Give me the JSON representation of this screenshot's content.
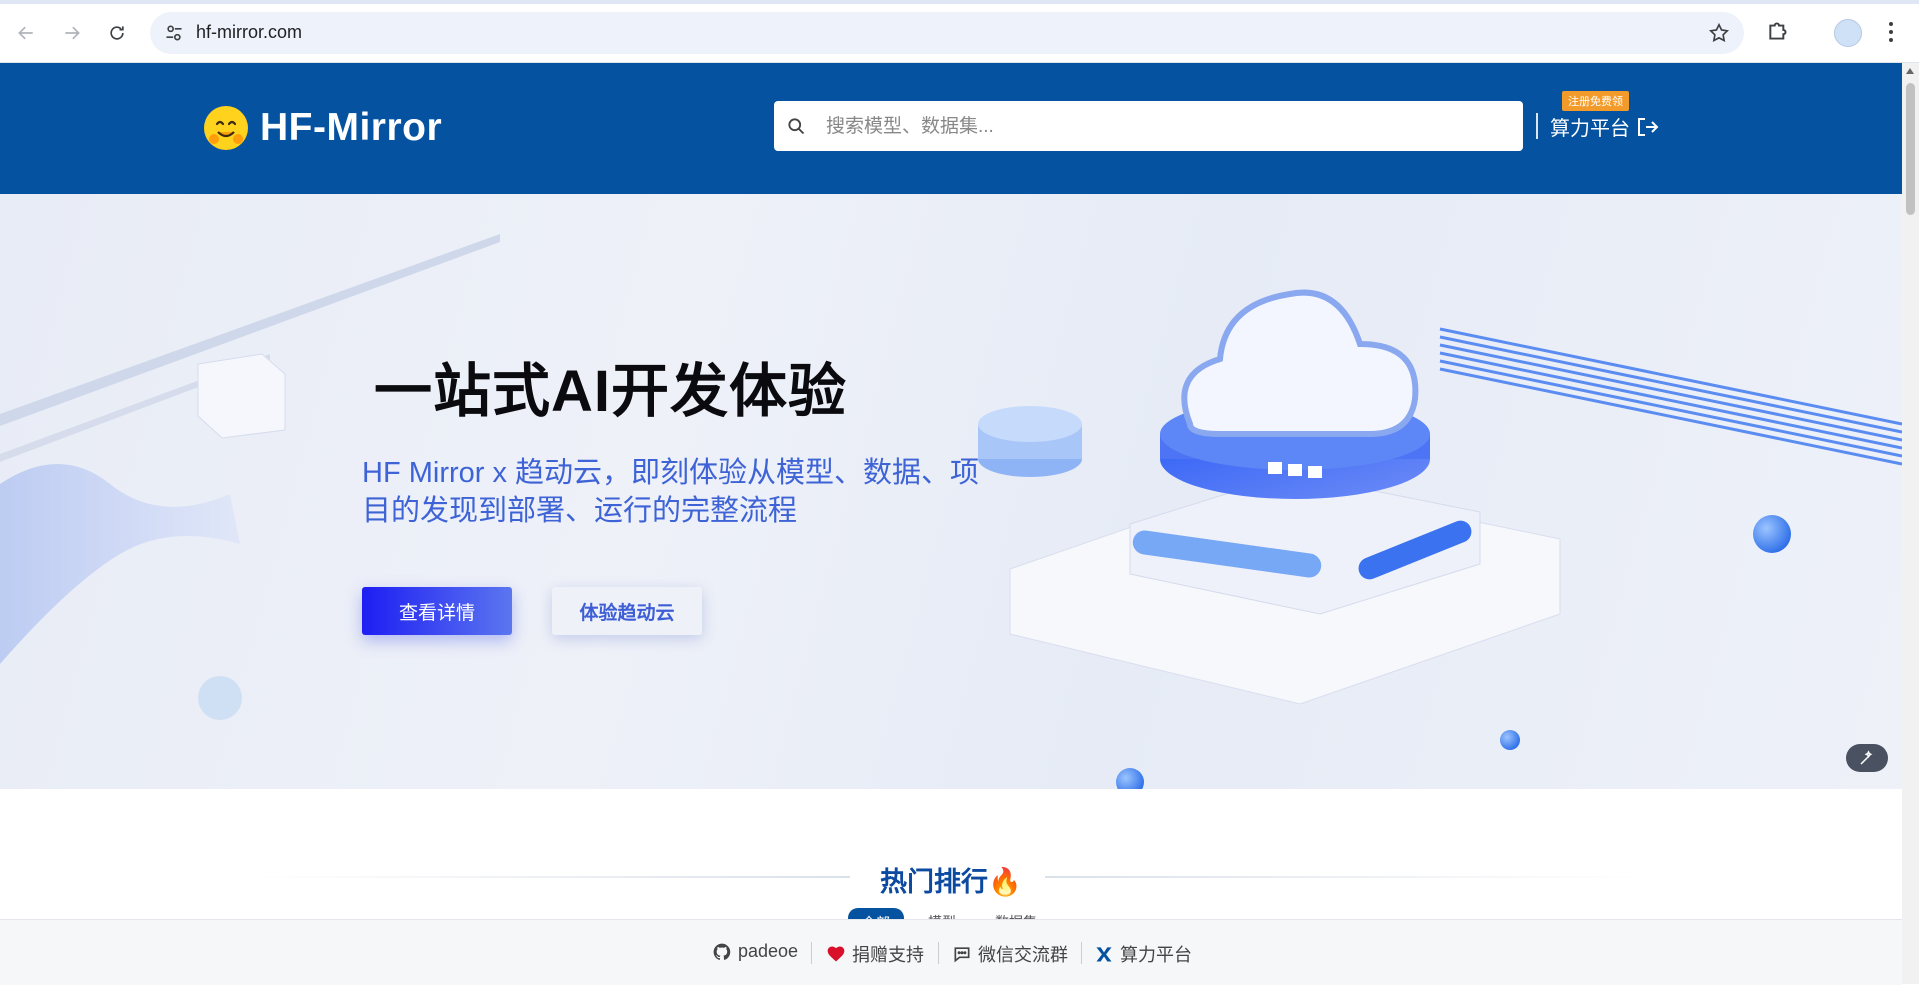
{
  "browser": {
    "url": "hf-mirror.com",
    "icons": {
      "back": "arrow-left-icon",
      "forward": "arrow-right-icon",
      "reload": "reload-icon",
      "site_info": "tune-icon",
      "bookmark": "star-icon",
      "extensions": "puzzle-icon",
      "menu": "kebab-menu-icon"
    }
  },
  "header": {
    "brand": "HF-Mirror",
    "search_placeholder": "搜索模型、数据集...",
    "compute_platform": "算力平台",
    "promo_badge": "注册免费领",
    "colors": {
      "background": "#0553a0",
      "badge": "#f39b2a"
    }
  },
  "hero": {
    "title": "一站式AI开发体验",
    "subtitle": "HF Mirror x 趋动云，即刻体验从模型、数据、项目的发现到部署、运行的完整流程",
    "primary_button": "查看详情",
    "secondary_button": "体验趋动云"
  },
  "ranking": {
    "title": "热门排行🔥",
    "tabs": [
      "全部",
      "模型",
      "数据集"
    ]
  },
  "footer": {
    "items": [
      {
        "label": "padeoe",
        "icon": "github-icon"
      },
      {
        "label": "捐赠支持",
        "icon": "heart-icon"
      },
      {
        "label": "微信交流群",
        "icon": "chat-icon"
      },
      {
        "label": "算力平台",
        "icon": "x-logo-icon"
      }
    ]
  }
}
